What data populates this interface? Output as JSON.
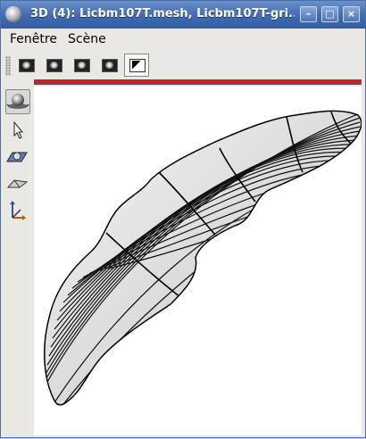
{
  "window": {
    "title": "3D (4): Licbm107T.mesh, Licbm107T-gri..."
  },
  "titlebar_buttons": {
    "minimize": "–",
    "maximize": "□",
    "close": "×"
  },
  "menu": {
    "items": [
      "Fenêtre",
      "Scène"
    ]
  },
  "toolbar": {
    "items": [
      {
        "icon": "brain-view-icon-1"
      },
      {
        "icon": "brain-view-icon-2"
      },
      {
        "icon": "brain-view-icon-3"
      },
      {
        "icon": "brain-view-icon-4"
      },
      {
        "icon": "black-white-render-icon",
        "active": true
      }
    ]
  },
  "left_tools": [
    {
      "icon": "trackball-rotate-icon",
      "active": true
    },
    {
      "icon": "pointer-select-icon"
    },
    {
      "icon": "oblique-slice-icon"
    },
    {
      "icon": "plane-cut-icon"
    },
    {
      "icon": "axes-transform-icon"
    }
  ],
  "accent_colors": {
    "title_bar": "#3f69b0",
    "red_bar": "#c8202a"
  }
}
